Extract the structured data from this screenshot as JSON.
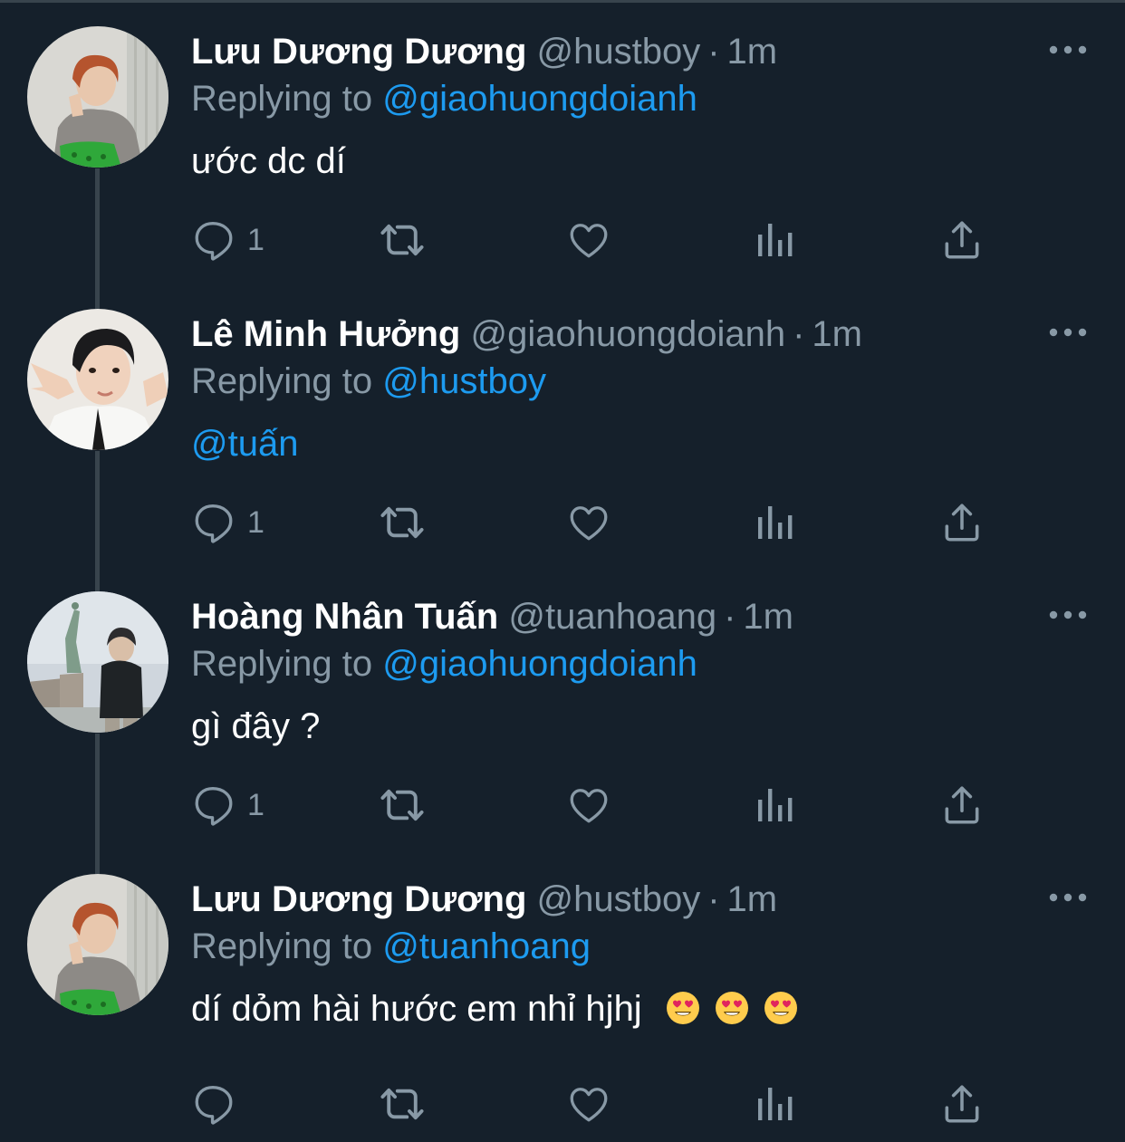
{
  "colors": {
    "background": "#15202b",
    "divider": "#38444d",
    "secondary_text": "#8899a6",
    "link": "#1d9bf0",
    "primary_text": "#ffffff"
  },
  "tweets": [
    {
      "name": "Lưu Dương Dương",
      "handle": "@hustboy",
      "separator": "·",
      "time": "1m",
      "replying_prefix": "Replying to",
      "replying_to": "@giaohuongdoianh",
      "text": "ước dc dí",
      "reply_count": "1",
      "avatar": "boy-grey-sweater-avatar"
    },
    {
      "name": "Lê Minh Hưởng",
      "handle": "@giaohuongdoianh",
      "separator": "·",
      "time": "1m",
      "replying_prefix": "Replying to",
      "replying_to": "@hustboy",
      "text": "@tuấn",
      "reply_count": "1",
      "avatar": "boy-peace-sign-avatar"
    },
    {
      "name": "Hoàng Nhân Tuấn",
      "handle": "@tuanhoang",
      "separator": "·",
      "time": "1m",
      "replying_prefix": "Replying to",
      "replying_to": "@giaohuongdoianh",
      "text": "gì đây ?",
      "reply_count": "1",
      "avatar": "statue-of-liberty-avatar"
    },
    {
      "name": "Lưu Dương Dương",
      "handle": "@hustboy",
      "separator": "·",
      "time": "1m",
      "replying_prefix": "Replying to",
      "replying_to": "@tuanhoang",
      "text": "dí dỏm hài hước em nhỉ hjhj",
      "reply_count": "",
      "emojis": [
        "heart-eyes-emoji",
        "heart-eyes-emoji",
        "heart-eyes-emoji"
      ],
      "avatar": "boy-grey-sweater-avatar"
    }
  ],
  "icons": {
    "reply": "reply-icon",
    "retweet": "retweet-icon",
    "like": "heart-icon",
    "analytics": "analytics-icon",
    "share": "share-icon",
    "more": "more-options-icon"
  }
}
